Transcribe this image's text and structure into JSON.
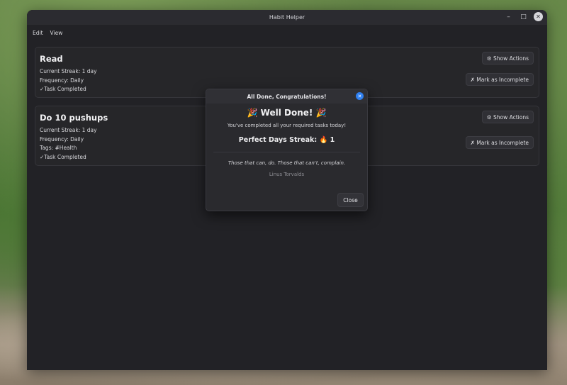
{
  "window": {
    "title": "Habit Helper",
    "minimize_glyph": "–",
    "maximize_glyph": "□",
    "close_glyph": "✕"
  },
  "menu": {
    "edit": "Edit",
    "view": "View"
  },
  "habits": [
    {
      "name": "Read",
      "streak": "Current Streak: 1 day",
      "frequency": "Frequency: Daily",
      "status": "✓Task Completed",
      "show_actions": "⚙ Show Actions",
      "mark_incomplete": "✗ Mark as Incomplete"
    },
    {
      "name": "Do 10 pushups",
      "streak": "Current Streak: 1 day",
      "frequency": "Frequency: Daily",
      "tags": "Tags:  #Health",
      "status": "✓Task Completed",
      "show_actions": "⚙ Show Actions",
      "mark_incomplete": "✗ Mark as Incomplete"
    }
  ],
  "dialog": {
    "title": "All Done, Congratulations!",
    "close_glyph": "✕",
    "heading": "🎉 Well Done! 🎉",
    "message": "You've completed all your required tasks today!",
    "streak": "Perfect Days Streak: 🔥 1",
    "quote": "Those that can, do. Those that can't, complain.",
    "author": "Linus Torvalds",
    "close_button": "Close"
  },
  "colors": {
    "accent": "#2e7ff0",
    "window_bg": "#222226",
    "card_bg": "#262629"
  }
}
